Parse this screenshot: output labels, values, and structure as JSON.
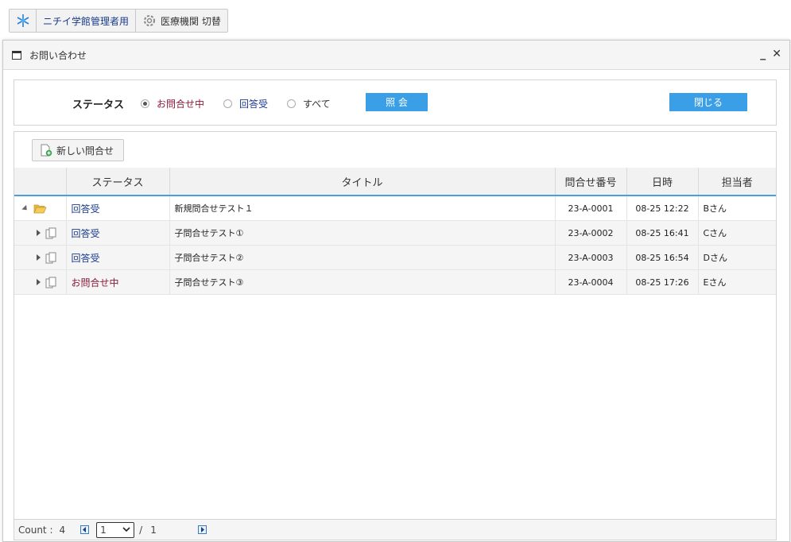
{
  "topbar": {
    "org_label": "ニチイ学館管理者用",
    "switch_label": "医療機関 切替"
  },
  "window": {
    "title": "お問い合わせ",
    "minimize": "_",
    "close": "✕"
  },
  "filter": {
    "label": "ステータス",
    "options": [
      {
        "label": "お問合せ中",
        "selected": true,
        "color": "#8b1a3a"
      },
      {
        "label": "回答受",
        "selected": false,
        "color": "#1a3a8a"
      },
      {
        "label": "すべて",
        "selected": false,
        "color": "#333333"
      }
    ],
    "search_button": "照 会",
    "close_button": "閉じる"
  },
  "grid": {
    "new_button": "新しい問合せ",
    "columns": [
      "",
      "ステータス",
      "タイトル",
      "問合せ番号",
      "日時",
      "担当者"
    ],
    "rows": [
      {
        "status": "回答受",
        "status_color": "#1a3a8a",
        "title": "新規問合せテスト１",
        "number": "23-A-0001",
        "datetime": "08-25 12:22",
        "assignee": "Bさん",
        "icon": "folder-open-icon"
      },
      {
        "status": "回答受",
        "status_color": "#1a3a8a",
        "title": "子問合せテスト①",
        "number": "23-A-0002",
        "datetime": "08-25 16:41",
        "assignee": "Cさん",
        "icon": "copy-icon"
      },
      {
        "status": "回答受",
        "status_color": "#1a3a8a",
        "title": "子問合せテスト②",
        "number": "23-A-0003",
        "datetime": "08-25 16:54",
        "assignee": "Dさん",
        "icon": "copy-icon"
      },
      {
        "status": "お問合せ中",
        "status_color": "#8b1a3a",
        "title": "子問合せテスト③",
        "number": "23-A-0004",
        "datetime": "08-25 17:26",
        "assignee": "Eさん",
        "icon": "copy-icon"
      }
    ]
  },
  "pager": {
    "count_label": "Count :",
    "count": "4",
    "page": "1",
    "separator": "/",
    "total_pages": "1"
  },
  "colors": {
    "accent": "#3a9fe6",
    "header_underline": "#4a9ee0"
  }
}
